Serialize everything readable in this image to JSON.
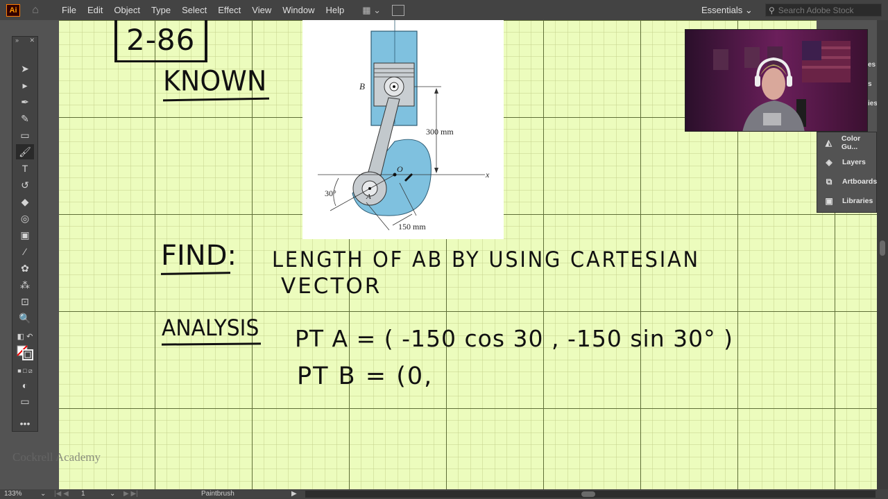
{
  "app": {
    "logo": "Ai",
    "home_icon": "home-icon"
  },
  "menu": {
    "items": [
      "File",
      "Edit",
      "Object",
      "Type",
      "Select",
      "Effect",
      "View",
      "Window",
      "Help"
    ]
  },
  "workspace": {
    "label": "Essentials",
    "search_placeholder": "Search Adobe Stock"
  },
  "figure": {
    "label_B": "B",
    "label_O": "O",
    "label_x": "x",
    "label_A": "A",
    "dim_300": "300 mm",
    "angle": "30°",
    "dim_150": "150 mm"
  },
  "notes": {
    "problem_number": "2-86",
    "known": "KNOWN",
    "find": "FIND:",
    "find_text_1": "LENGTH OF AB BY USING CARTESIAN",
    "find_text_2": "VECTOR",
    "analysis": "ANALYSIS",
    "pt_a": "PT A = ( -150 cos 30 , -150 sin 30° )",
    "pt_b": "PT B = (0,"
  },
  "panels": {
    "items": [
      {
        "label": "Color Gu...",
        "icon": "color-guide-icon"
      },
      {
        "label": "Layers",
        "icon": "layers-icon"
      },
      {
        "label": "Artboards",
        "icon": "artboards-icon"
      },
      {
        "label": "Libraries",
        "icon": "libraries-icon"
      }
    ],
    "partial": [
      "es",
      "s",
      "ies"
    ]
  },
  "status": {
    "zoom": "133%",
    "artboard": "1",
    "tool": "Paintbrush"
  },
  "watermark": "Cockrell Academy",
  "colors": {
    "canvas": "#ecfcbd",
    "grid_major": "#5e6e36",
    "figure_blue": "#7fc1df",
    "ai_orange": "#ff9a00"
  }
}
